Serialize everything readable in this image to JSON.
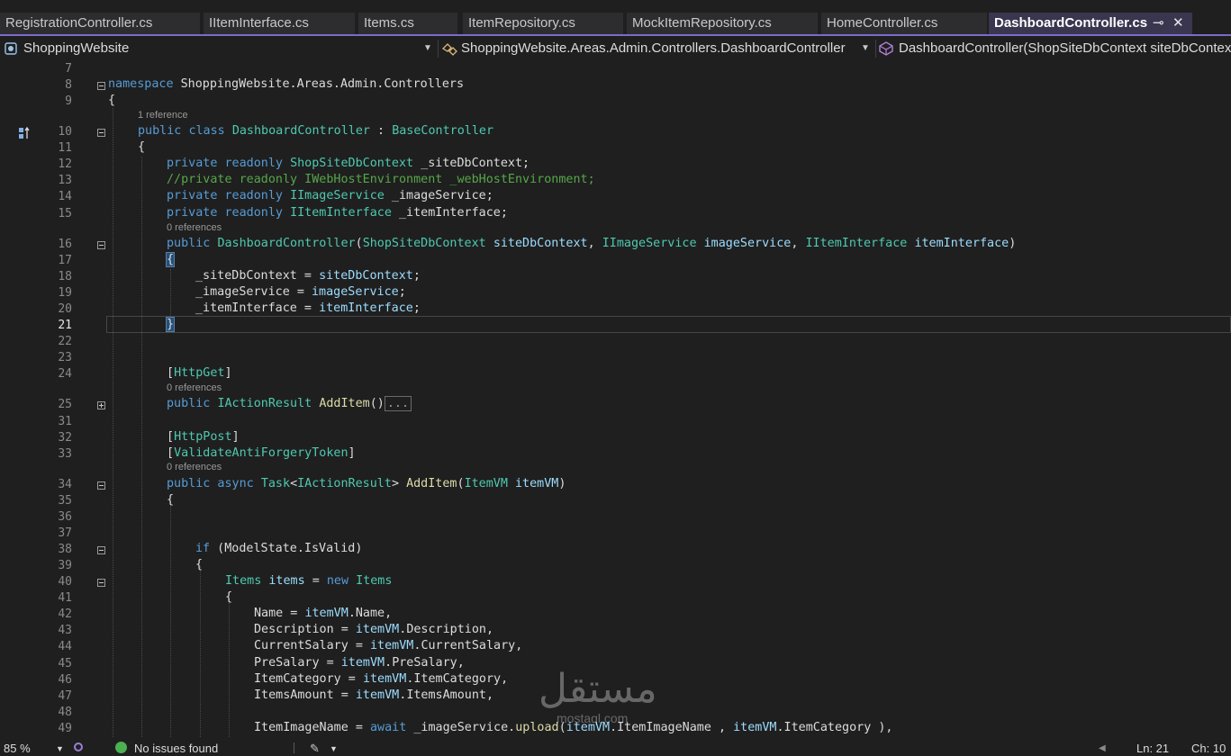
{
  "tabs": [
    {
      "label": "RegistrationController.cs"
    },
    {
      "label": "IItemInterface.cs"
    },
    {
      "label": "Items.cs"
    },
    {
      "label": "ItemRepository.cs"
    },
    {
      "label": "MockItemRepository.cs"
    },
    {
      "label": "HomeController.cs"
    },
    {
      "label": "DashboardController.cs",
      "active": true
    }
  ],
  "tab_controls": {
    "pin": "⊸",
    "close": "✕"
  },
  "navbar": {
    "project": "ShoppingWebsite",
    "type": "ShoppingWebsite.Areas.Admin.Controllers.DashboardController",
    "member": "DashboardController(ShopSiteDbContext siteDbContext"
  },
  "code": {
    "references": {
      "class": "1 reference",
      "ctor": "0 references",
      "get": "0 references",
      "post": "0 references"
    },
    "line_numbers": [
      "7",
      "8",
      "9",
      "10",
      "11",
      "12",
      "13",
      "14",
      "15",
      "16",
      "17",
      "18",
      "19",
      "20",
      "21",
      "22",
      "23",
      "24",
      "25",
      "31",
      "32",
      "33",
      "34",
      "35",
      "36",
      "37",
      "38",
      "39",
      "40",
      "41",
      "42",
      "43",
      "44",
      "45",
      "46",
      "47",
      "48",
      "49"
    ],
    "current_line": "21",
    "lines": {
      "l8": {
        "kw": "namespace",
        "rest": " ShoppingWebsite.Areas.Admin.Controllers"
      },
      "l9": "{",
      "l10": {
        "kw1": "public",
        "kw2": "class",
        "name": "DashboardController",
        "sep": " : ",
        "base": "BaseController"
      },
      "l11": "{",
      "l12": {
        "kw": "private readonly",
        "type": "ShopSiteDbContext",
        "rest": " _siteDbContext;"
      },
      "l13": "//private readonly IWebHostEnvironment _webHostEnvironment;",
      "l14": {
        "kw": "private readonly",
        "type": "IImageService",
        "rest": " _imageService;"
      },
      "l15": {
        "kw": "private readonly",
        "type": "IItemInterface",
        "rest": " _itemInterface;"
      },
      "l16": {
        "kw": "public",
        "name": "DashboardController",
        "p1t": "ShopSiteDbContext",
        "p1": "siteDbContext",
        "p2t": "IImageService",
        "p2": "imageService",
        "p3t": "IItemInterface",
        "p3": "itemInterface"
      },
      "l17": "{",
      "l18": {
        "lhs": "_siteDbContext = ",
        "rhs": "siteDbContext",
        "end": ";"
      },
      "l19": {
        "lhs": "_imageService = ",
        "rhs": "imageService",
        "end": ";"
      },
      "l20": {
        "lhs": "_itemInterface = ",
        "rhs": "itemInterface",
        "end": ";"
      },
      "l21": "}",
      "l24": {
        "attr": "HttpGet"
      },
      "l25": {
        "kw": "public",
        "type": "IActionResult",
        "fn": "AddItem",
        "paren": "()",
        "collapsed": "..."
      },
      "l32": {
        "attr": "HttpPost"
      },
      "l33": {
        "attr": "ValidateAntiForgeryToken"
      },
      "l34": {
        "kw": "public async",
        "type1": "Task",
        "type2": "IActionResult",
        "fn": "AddItem",
        "ptype": "ItemVM",
        "param": "itemVM"
      },
      "l35": "{",
      "l38": {
        "kw": "if",
        "rest": " (ModelState.IsValid)"
      },
      "l39": "{",
      "l40": {
        "type": "Items",
        "var": "items",
        "kw": "new",
        "type2": "Items"
      },
      "l41": "{",
      "l42": {
        "prop": "Name",
        "src": "itemVM",
        "field": "Name"
      },
      "l43": {
        "prop": "Description",
        "src": "itemVM",
        "field": "Description"
      },
      "l44": {
        "prop": "CurrentSalary",
        "src": "itemVM",
        "field": "CurrentSalary"
      },
      "l45": {
        "prop": "PreSalary",
        "src": "itemVM",
        "field": "PreSalary"
      },
      "l46": {
        "prop": "ItemCategory",
        "src": "itemVM",
        "field": "ItemCategory"
      },
      "l47": {
        "prop": "ItemsAmount",
        "src": "itemVM",
        "field": "ItemsAmount"
      },
      "l49": {
        "lhs": "ItemImageName = ",
        "kw": "await",
        "obj": " _imageService.",
        "fn": "upload",
        "a1": "itemVM",
        "a1f": ".ItemImageName , ",
        "a2": "itemVM",
        "a2f": ".ItemCategory ),"
      }
    }
  },
  "statusbar": {
    "zoom": "85 %",
    "issues": "No issues found",
    "line": "Ln: 21",
    "col": "Ch: 10"
  },
  "watermark": {
    "arabic": "مستقل",
    "latin": "mostaql.com"
  },
  "colors": {
    "keyword": "#569cd6",
    "type": "#4ec9b0",
    "comment": "#57a64a",
    "param": "#9cdcfe",
    "method": "#dcdcaa",
    "accent": "#7c6bc9"
  }
}
